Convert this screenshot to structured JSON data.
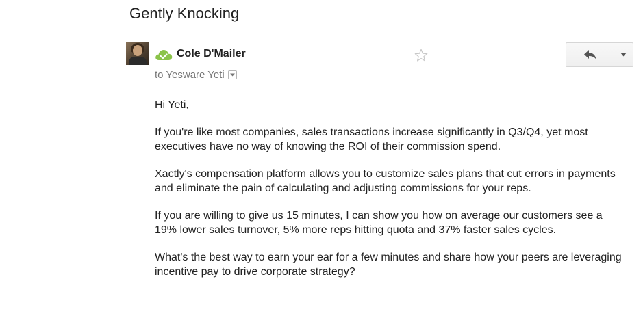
{
  "email": {
    "subject": "Gently Knocking",
    "sender_name": "Cole D'Mailer",
    "recipient_line": "to Yesware Yeti",
    "sender_icon": "cloud-check-icon",
    "accent_color": "#8bc34a",
    "greeting": "Hi Yeti,",
    "paragraphs": [
      "If you're like most companies, sales transactions increase significantly in Q3/Q4, yet most executives have no way of knowing the ROI of their commission spend.",
      "Xactly's compensation platform allows you to customize sales plans that cut errors in payments and eliminate the pain of calculating and adjusting commissions for your reps.",
      "If you are willing to give us 15 minutes, I can show you how on average our customers see a 19% lower sales turnover, 5% more reps hitting quota and 37% faster sales cycles.",
      "What's the best way to earn your ear for a few minutes and share how your peers are leveraging incentive pay to drive corporate strategy?"
    ]
  },
  "toolbar": {
    "star_icon": "star-outline-icon",
    "reply_icon": "reply-arrow-icon",
    "more_icon": "caret-down-icon"
  }
}
